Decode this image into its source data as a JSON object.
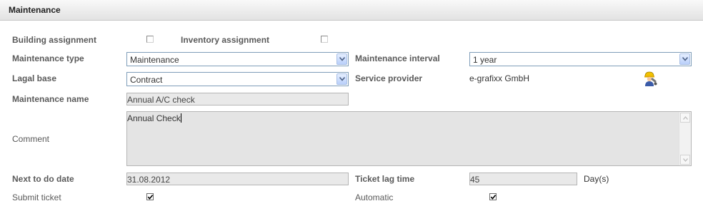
{
  "header": {
    "title": "Maintenance"
  },
  "form": {
    "building_assignment": {
      "label": "Building assignment",
      "checked": false
    },
    "inventory_assignment": {
      "label": "Inventory assignment",
      "checked": false
    },
    "maintenance_type": {
      "label": "Maintenance type",
      "value": "Maintenance"
    },
    "maintenance_interval": {
      "label": "Maintenance interval",
      "value": "1 year"
    },
    "legal_base": {
      "label": "Lagal base",
      "value": "Contract"
    },
    "service_provider": {
      "label": "Service provider",
      "value": "e-grafixx GmbH",
      "icon": "worker-icon"
    },
    "maintenance_name": {
      "label": "Maintenance name",
      "value": "Annual A/C check"
    },
    "comment": {
      "label": "Comment",
      "value": "Annual Check"
    },
    "next_to_do_date": {
      "label": "Next to do date",
      "value": "31.08.2012"
    },
    "ticket_lag_time": {
      "label": "Ticket lag time",
      "value": "45",
      "unit": "Day(s)"
    },
    "submit_ticket": {
      "label": "Submit ticket",
      "checked": true
    },
    "automatic": {
      "label": "Automatic",
      "checked": true
    }
  },
  "colors": {
    "select_border": "#7f9db9",
    "field_bg": "#e9e9e9",
    "header_bg": "#e2e2e2"
  }
}
